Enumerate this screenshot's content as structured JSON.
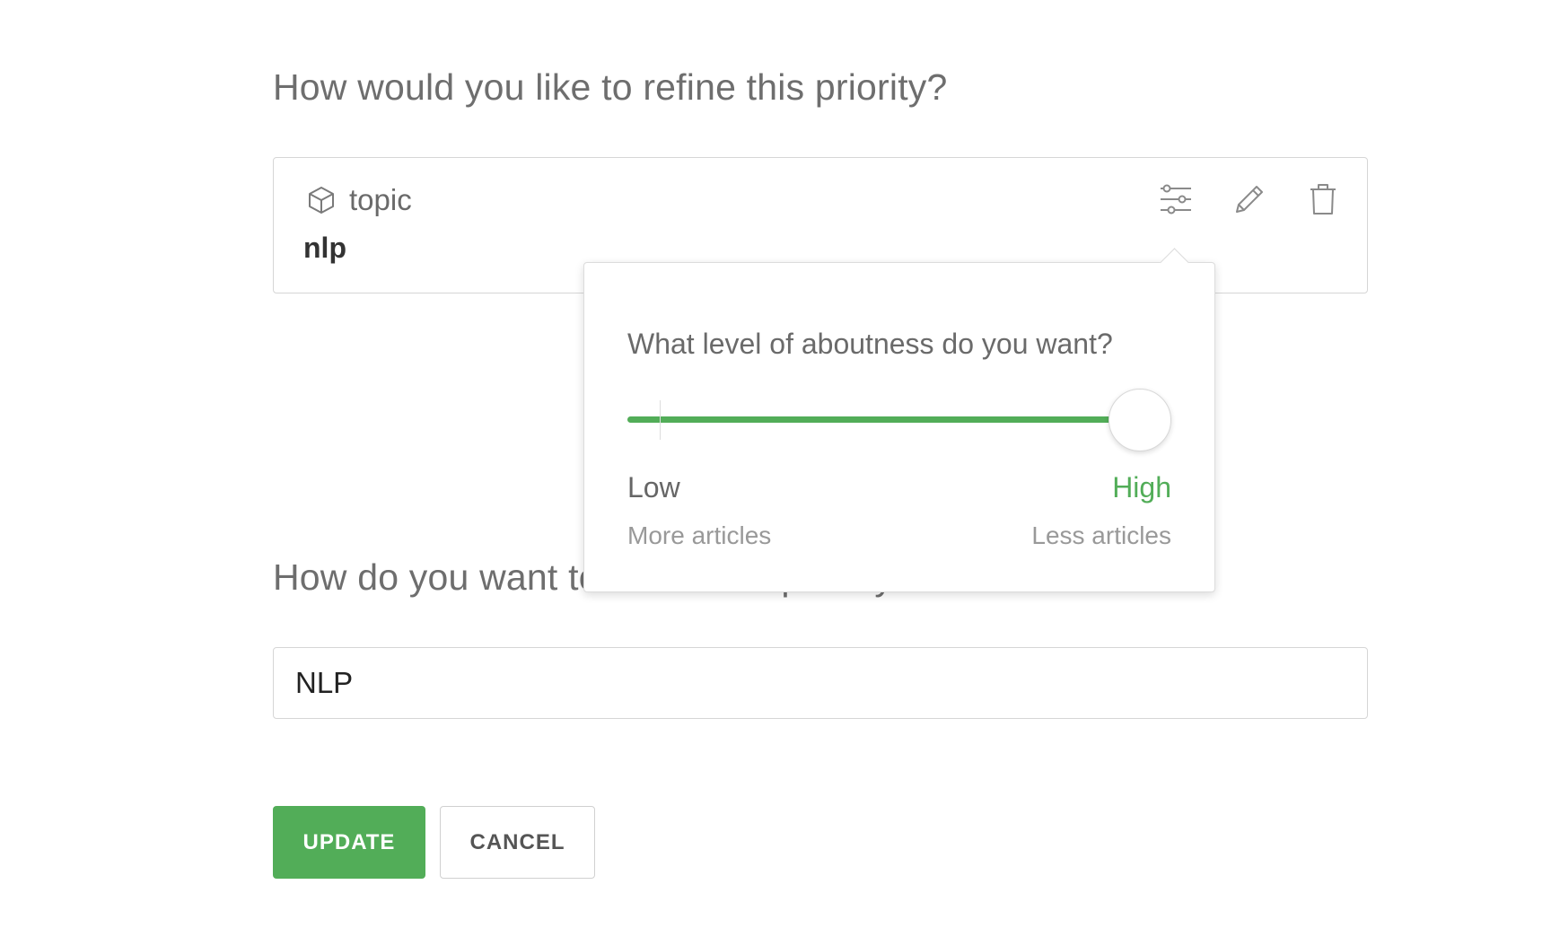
{
  "refine": {
    "question": "How would you like to refine this priority?"
  },
  "priority_card": {
    "type_icon": "cube-icon",
    "type_label": "topic",
    "value": "nlp",
    "actions": [
      {
        "name": "filter-settings-button",
        "icon": "sliders-icon"
      },
      {
        "name": "edit-button",
        "icon": "pencil-icon"
      },
      {
        "name": "delete-button",
        "icon": "trash-icon"
      }
    ]
  },
  "aboutness_popover": {
    "title": "What level of aboutness do you want?",
    "slider_level": 1.0,
    "accent_color": "#52ad58",
    "low_label": "Low",
    "low_sub": "More articles",
    "high_label": "High",
    "high_sub": "Less articles"
  },
  "name": {
    "question": "How do you want to name this priority?",
    "value": "NLP"
  },
  "buttons": {
    "update": "UPDATE",
    "cancel": "CANCEL"
  }
}
